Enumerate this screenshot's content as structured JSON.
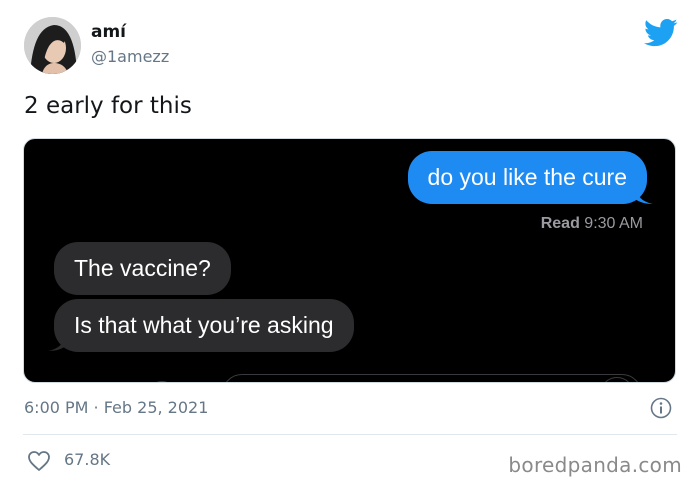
{
  "author": {
    "display_name": "amí",
    "handle": "@1amezz"
  },
  "tweet": {
    "text": "2 early for this",
    "timestamp": "6:00 PM · Feb 25, 2021",
    "likes": "67.8K"
  },
  "conversation": {
    "outgoing": "do you like the cure",
    "read_label": "Read",
    "read_time": "9:30 AM",
    "incoming": [
      "The vaccine?",
      "Is that what you’re asking"
    ]
  },
  "icons": {
    "brand": "twitter-bird-icon",
    "info": "info-icon",
    "like": "heart-icon"
  },
  "colors": {
    "twitter_blue": "#1da1f2",
    "imessage_blue": "#1e8bf3",
    "incoming_bubble": "#2c2c2e",
    "secondary_text": "#657786"
  },
  "watermark": "boredpanda.com"
}
